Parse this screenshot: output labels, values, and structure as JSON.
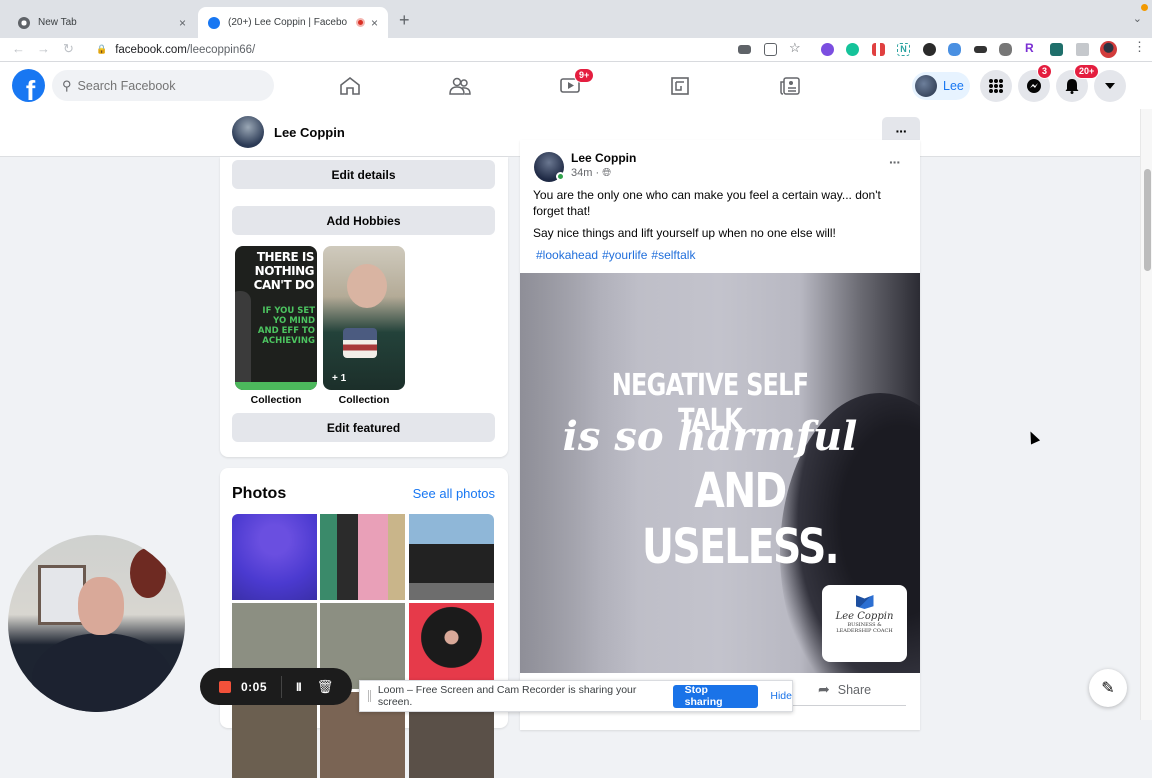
{
  "browser": {
    "tabs": [
      {
        "label": "New Tab",
        "active": false
      },
      {
        "label": "(20+) Lee Coppin | Facebo",
        "active": true,
        "recording": true
      }
    ],
    "new_tab_symbol": "+",
    "close_symbol": "×",
    "url_domain": "facebook.com",
    "url_path": "/leecoppin66/",
    "extensions": [
      "camera-icon",
      "share-icon",
      "star-icon",
      "ext-purple-gear",
      "grammarly-icon",
      "ext-red-bars",
      "notion-n-icon",
      "ext-dark-circle",
      "ext-blue-bird",
      "ext-bee",
      "ext-elephant",
      "ext-r-icon",
      "ext-green-box",
      "puzzle-icon",
      "profile-avatar",
      "kebab-menu-icon"
    ]
  },
  "facebook_nav": {
    "search_placeholder": "Search Facebook",
    "watch_badge": "9+",
    "profile_name": "Lee",
    "messenger_badge": "3",
    "notifications_badge": "20+"
  },
  "profile_bar": {
    "name": "Lee Coppin",
    "more_label": "···"
  },
  "intro": {
    "edit_details": "Edit details",
    "add_hobbies": "Add Hobbies",
    "featured": [
      {
        "label": "Collection",
        "text_white": "THERE IS NOTHING CAN'T DO",
        "text_green": "IF YOU SET YO MIND AND EFF TO ACHIEVING"
      },
      {
        "label": "Collection",
        "count": "+ 1"
      }
    ],
    "edit_featured": "Edit featured"
  },
  "photos": {
    "title": "Photos",
    "see_all": "See all photos"
  },
  "post": {
    "author": "Lee Coppin",
    "time": "34m",
    "audience_icon": "globe-icon",
    "more": "···",
    "line1": "You are the only one who can make you feel a certain way... don't forget that!",
    "line2": "Say nice things and lift yourself up when no one else will!",
    "hashtags": [
      "#lookahead",
      "#yourlife",
      "#selftalk"
    ],
    "image_quote": [
      "NEGATIVE SELF TALK",
      "is so harmful",
      "AND USELESS."
    ],
    "brand": {
      "signature": "Lee Coppin",
      "subtitle1": "BUSINESS &",
      "subtitle2": "LEADERSHIP COACH"
    },
    "share_label": "Share"
  },
  "loom": {
    "elapsed": "0:05",
    "pause_symbol": "II",
    "banner_text": "Loom – Free Screen and Cam Recorder is sharing your screen.",
    "stop_sharing": "Stop sharing",
    "hide": "Hide"
  },
  "colors": {
    "facebook_blue": "#1877f2",
    "badge_red": "#e41e3f",
    "chrome_blue": "#1a73e8",
    "loom_red": "#f2513a"
  }
}
